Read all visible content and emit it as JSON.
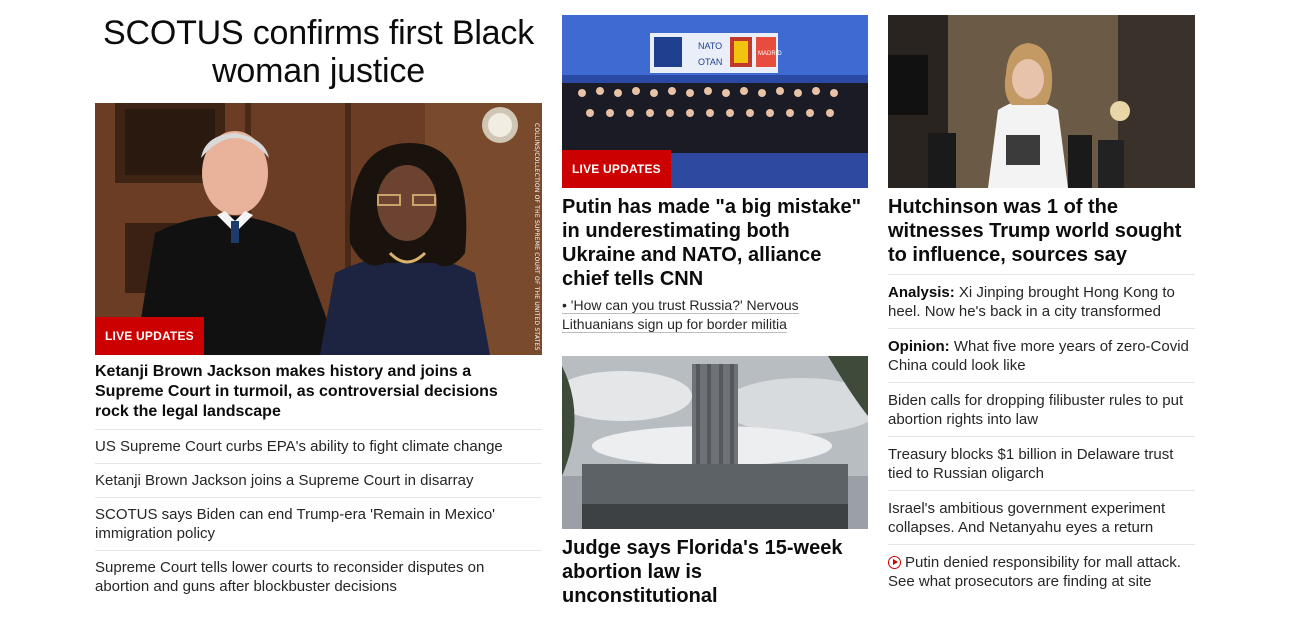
{
  "col1": {
    "headline": "SCOTUS confirms first Black woman justice",
    "image_credit": "COLLINS/COLLECTION OF THE SUPREME COURT OF THE UNITED STATES",
    "live_label": "LIVE UPDATES",
    "lead": "Ketanji Brown Jackson makes history and joins a Supreme Court in turmoil, as controversial decisions rock the legal landscape",
    "links": [
      "US Supreme Court curbs EPA's ability to fight climate change",
      "Ketanji Brown Jackson joins a Supreme Court in disarray",
      "SCOTUS says Biden can end Trump-era 'Remain in Mexico' immigration policy",
      "Supreme Court tells lower courts to reconsider disputes on abortion and guns after blockbuster decisions"
    ]
  },
  "col2": {
    "live_label": "LIVE UPDATES",
    "nato_banner": [
      "NATO",
      "OTAN",
      "MADRID"
    ],
    "headline1": "Putin has made \"a big mistake\" in underestimating both Ukraine and NATO, alliance chief tells CNN",
    "sub1": "• 'How can you trust Russia?' Nervous Lithuanians sign up for border militia",
    "headline2": "Judge says Florida's 15-week abortion law is unconstitutional"
  },
  "col3": {
    "headline": "Hutchinson was 1 of the witnesses Trump world sought to influence, sources say",
    "links": [
      {
        "prefix": "Analysis:",
        "text": " Xi Jinping brought Hong Kong to heel. Now he's back in a city transformed"
      },
      {
        "prefix": "Opinion:",
        "text": " What five more years of zero-Covid China could look like"
      },
      {
        "prefix": "",
        "text": "Biden calls for dropping filibuster rules to put abortion rights into law"
      },
      {
        "prefix": "",
        "text": "Treasury blocks $1 billion in Delaware trust tied to Russian oligarch"
      },
      {
        "prefix": "",
        "text": "Israel's ambitious government experiment collapses. And Netanyahu eyes a return"
      },
      {
        "prefix": "",
        "text": "Putin denied responsibility for mall attack. See what prosecutors are finding at site",
        "icon": "play-video-icon"
      }
    ]
  },
  "colors": {
    "accent_red": "#cc0000",
    "text": "#0c0c0c",
    "divider": "#e6e6e6"
  }
}
